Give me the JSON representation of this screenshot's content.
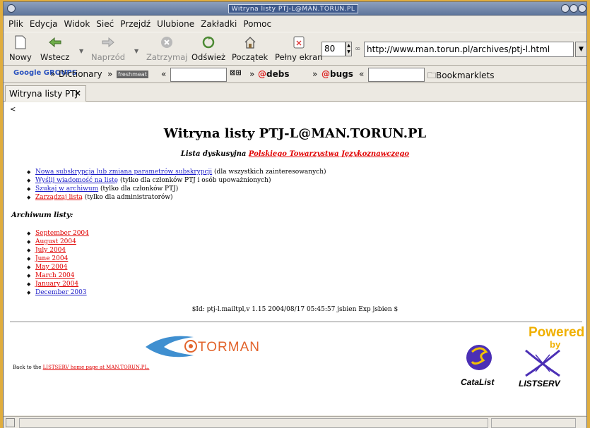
{
  "window": {
    "title": "Witryna listy PTJ-L@MAN.TORUN.PL"
  },
  "menu": [
    "Plik",
    "Edycja",
    "Widok",
    "Sieć",
    "Przejdź",
    "Ulubione",
    "Zakładki",
    "Pomoc"
  ],
  "toolbar": {
    "new_label": "Nowy",
    "back_label": "Wstecz",
    "forward_label": "Naprzód",
    "stop_label": "Zatrzymaj",
    "reload_label": "Odśwież",
    "home_label": "Początek",
    "fullscreen_label": "Pełny ekran",
    "zoom_value": "80",
    "url_value": "http://www.man.torun.pl/archives/ptj-l.html"
  },
  "bookmarks": {
    "google_label": "Google GROUPS",
    "dictionary_label": "Dictionary",
    "freshmeat_label": "freshmeat",
    "debs_label": "debs",
    "bugs_label": "bugs",
    "bookmarklets_label": "Bookmarklets"
  },
  "tab": {
    "label": "Witryna listy PTJ",
    "close": "×"
  },
  "page": {
    "back_link": "<",
    "heading": "Witryna listy PTJ-L@MAN.TORUN.PL",
    "subtitle_prefix": "Lista dyskusyjna ",
    "subtitle_link": "Polskiego Towarzystwa Językoznawczego",
    "ops": [
      {
        "link": "Nowa subskrypcja lub zmiana parametrów subskrypcji",
        "note": " (dla wszystkich zainteresowanych)",
        "color": "blue"
      },
      {
        "link": "Wyślij wiadomość na listę",
        "note": " (tylko dla członków PTJ i osób upoważnionych)",
        "color": "blue"
      },
      {
        "link": "Szukaj w archiwum",
        "note": " (tylko dla członków PTJ)",
        "color": "blue"
      },
      {
        "link": "Zarządzaj listą",
        "note": " (tylko dla administratorów)",
        "color": "red"
      }
    ],
    "archive_heading": "Archiwum listy:",
    "archives": [
      {
        "label": "September 2004",
        "color": "red"
      },
      {
        "label": "August 2004",
        "color": "red"
      },
      {
        "label": "July 2004",
        "color": "red"
      },
      {
        "label": "June 2004",
        "color": "red"
      },
      {
        "label": "May 2004",
        "color": "red"
      },
      {
        "label": "March 2004",
        "color": "red"
      },
      {
        "label": "January 2004",
        "color": "red"
      },
      {
        "label": "December 2003",
        "color": "blue"
      }
    ],
    "revision_id": "$Id: ptj-l.mailtpl,v 1.15 2004/08/17 05:45:57 jsbien Exp jsbien $",
    "back_home_prefix": "Back to the ",
    "back_home_link": "LISTSERV home page at MAN.TORUN.PL.",
    "torman_logo_text": "TORMAN",
    "catalist_text": "CataList",
    "listserv_powered": "Powered",
    "listserv_by": "by",
    "listserv_text": "LISTSERV"
  },
  "colors": {
    "link_blue": "#1d1dc7",
    "link_red": "#e00000",
    "desktop": "#e0ad3e"
  }
}
